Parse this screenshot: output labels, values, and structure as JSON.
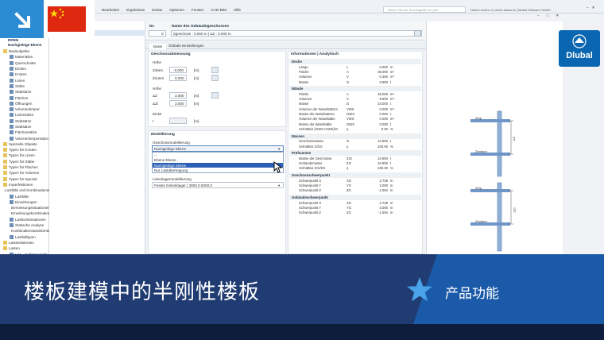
{
  "app": {
    "menu": [
      "Bearbeiten",
      "Ergebnisse",
      "Extras",
      "Optionen",
      "Fenster",
      "CAD-BIM",
      "Hilfe"
    ],
    "search_placeholder": "Geben Sie die Suchbegriffe ein (Alt+",
    "license": "Online-Lizenz 4 | ulrich.kroiss.ai | Dlubal Software GmbH"
  },
  "navigator": {
    "root": "RFEM",
    "project": "Nachgiebige Ebene",
    "items": [
      {
        "label": "Basisobjekte",
        "depth": 0,
        "folder": true
      },
      {
        "label": "Materialien",
        "depth": 1
      },
      {
        "label": "Querschnitte",
        "depth": 1
      },
      {
        "label": "Dicken",
        "depth": 1
      },
      {
        "label": "Knoten",
        "depth": 1
      },
      {
        "label": "Linien",
        "depth": 1
      },
      {
        "label": "Stäbe",
        "depth": 1
      },
      {
        "label": "Stabsätze",
        "depth": 1
      },
      {
        "label": "Flächen",
        "depth": 1
      },
      {
        "label": "Öffnungen",
        "depth": 1
      },
      {
        "label": "Volumenkörper",
        "depth": 1
      },
      {
        "label": "Liniensätze",
        "depth": 1
      },
      {
        "label": "Stabsätze",
        "depth": 1
      },
      {
        "label": "Stabsätze",
        "depth": 1
      },
      {
        "label": "Flächensätze",
        "depth": 1
      },
      {
        "label": "Volumenkörpersätze",
        "depth": 1
      },
      {
        "label": "Spezielle Objekte",
        "depth": 0,
        "folder": true
      },
      {
        "label": "Typen für Knoten",
        "depth": 0,
        "folder": true
      },
      {
        "label": "Typen für Linien",
        "depth": 0,
        "folder": true
      },
      {
        "label": "Typen für Stäbe",
        "depth": 0,
        "folder": true
      },
      {
        "label": "Typen für Flächen",
        "depth": 0,
        "folder": true
      },
      {
        "label": "Typen für Volumen",
        "depth": 0,
        "folder": true
      },
      {
        "label": "Typen für Spezial",
        "depth": 0,
        "folder": true
      },
      {
        "label": "Imperfektionen",
        "depth": 0,
        "folder": true
      },
      {
        "label": "Lastfälle und Kombinationen",
        "depth": 0,
        "folder": true
      },
      {
        "label": "Lastfälle",
        "depth": 1
      },
      {
        "label": "Einwirkungen",
        "depth": 1
      },
      {
        "label": "Bemessungssituationen",
        "depth": 1
      },
      {
        "label": "Einwirkungskombinationen",
        "depth": 1
      },
      {
        "label": "Lastkombinationen",
        "depth": 1
      },
      {
        "label": "Statische Analyse",
        "depth": 1
      },
      {
        "label": "Kombinationsassistenten",
        "depth": 1
      },
      {
        "label": "Lastfalltypen",
        "depth": 1
      },
      {
        "label": "Lastassistenten",
        "depth": 0,
        "folder": true
      },
      {
        "label": "Lasten",
        "depth": 0,
        "folder": true
      },
      {
        "label": "LF1 - Selbstgewicht",
        "depth": 1
      }
    ],
    "selected_row": "1   Geb Wand  III"
  },
  "dialog": {
    "no_label": "Nr.",
    "no_value": "0",
    "name_label": "Name des Gebäudegeschosses",
    "name_value": "Zgeschoss : 3.000 m | ΔZ : 3.000 m",
    "tabs": [
      "Basis",
      "Globale Einstellungen"
    ],
    "story_section": "Geschossabmessung",
    "hoehe_label": "Höhe",
    "z_oben_label": "Zoben",
    "z_oben_value": "-3.000",
    "z_unten_label": "Zunten",
    "z_unten_value": "0.000",
    "hoehe2_label": "Höhe",
    "dz_label": "ΔZ",
    "dz_value": "3.000",
    "dzi_label": "ΔZi",
    "dzi_value": "3.000",
    "dicke_label": "Dicke",
    "t_label": "t",
    "unit_m": "[m]",
    "unit_mm": "[m]",
    "modelling_section": "Modellierung",
    "geschoss_label": "Geschossmodellierung",
    "dropdown_value": "Nachgiebige Ebene",
    "options": [
      "--",
      "Ebene Ebene",
      "Nachgiebige Ebene",
      "Nur Lastübertragung"
    ],
    "linien_label": "Linienlagermodellierung",
    "linien_value": "Festes Gelenklager | 3000.0 5000.0"
  },
  "info": {
    "header": "Informationen | Analytisch",
    "groups": [
      {
        "title": "Decke",
        "rows": [
          {
            "n": "Länge",
            "s": "L",
            "v": "0.000",
            "u": "m"
          },
          {
            "n": "Fläche",
            "s": "A",
            "v": "36.000",
            "u": "m²"
          },
          {
            "n": "Volumen",
            "s": "V",
            "v": "0.360",
            "u": "m³"
          },
          {
            "n": "Masse",
            "s": "G",
            "v": "0.900",
            "u": "t"
          }
        ]
      },
      {
        "title": "Wände",
        "rows": [
          {
            "n": "Fläche",
            "s": "A",
            "v": "48.000",
            "u": "m²"
          },
          {
            "n": "Volumen",
            "s": "V",
            "v": "9.600",
            "u": "m³"
          },
          {
            "n": "Masse",
            "s": "G",
            "v": "24.000",
            "u": "t"
          },
          {
            "n": "Volumen der Wandstützen",
            "s": "VWS",
            "v": "0.000",
            "u": "m³"
          },
          {
            "n": "Masse der Wandstützen",
            "s": "GWS",
            "v": "0.000",
            "u": "t"
          },
          {
            "n": "Volumen der Wandstäbe",
            "s": "VWS",
            "v": "0.000",
            "u": "m³"
          },
          {
            "n": "Masse der Wandstäbe",
            "s": "GWS",
            "v": "0.000",
            "u": "t"
          },
          {
            "n": "Verhältnis (GWS+GWS)/G",
            "s": "η",
            "v": "0.00",
            "u": "%"
          }
        ]
      },
      {
        "title": "Massen",
        "rows": [
          {
            "n": "Geschossmasse",
            "s": "G",
            "v": "24.900",
            "u": "t"
          },
          {
            "n": "Verhältnis G/ΣG",
            "s": "η",
            "v": "100.00",
            "u": "%"
          }
        ]
      },
      {
        "title": "Prüfsumme",
        "rows": [
          {
            "n": "Masse der Geschosse",
            "s": "ΣGi",
            "v": "24.900",
            "u": "t"
          },
          {
            "n": "Gebäudemasse",
            "s": "ΣG",
            "v": "24.900",
            "u": "t"
          },
          {
            "n": "Verhältnis ΣGi/ΣG",
            "s": "η",
            "v": "100.00",
            "u": "%"
          }
        ]
      },
      {
        "title": "Geschossschwerpunkt",
        "rows": [
          {
            "n": "Schwerpunkt X",
            "s": "XG",
            "v": "2.739",
            "u": "m"
          },
          {
            "n": "Schwerpunkt Y",
            "s": "YG",
            "v": "3.000",
            "u": "m"
          },
          {
            "n": "Schwerpunkt Z",
            "s": "ZG",
            "v": "-1.554",
            "u": "m"
          }
        ]
      },
      {
        "title": "Gebäudeschwerpunkt",
        "rows": [
          {
            "n": "Schwerpunkt X",
            "s": "XG",
            "v": "2.739",
            "u": "m"
          },
          {
            "n": "Schwerpunkt Y",
            "s": "YG",
            "v": "3.000",
            "u": "m"
          },
          {
            "n": "Schwerpunkt Z",
            "s": "ZG",
            "v": "-1.554",
            "u": "m"
          }
        ]
      }
    ]
  },
  "diagram": {
    "labels": [
      "Ztop",
      "Zbottom",
      "ΔZ",
      "Ztop",
      "Zbottom",
      "ΔZi"
    ]
  },
  "overlay": {
    "title": "楼板建模中的半刚性楼板",
    "category": "产品功能",
    "logo_text": "Dlubal"
  },
  "colors": {
    "banner": "#203c72",
    "accent": "#0a66b0",
    "flag": "#de2910"
  }
}
